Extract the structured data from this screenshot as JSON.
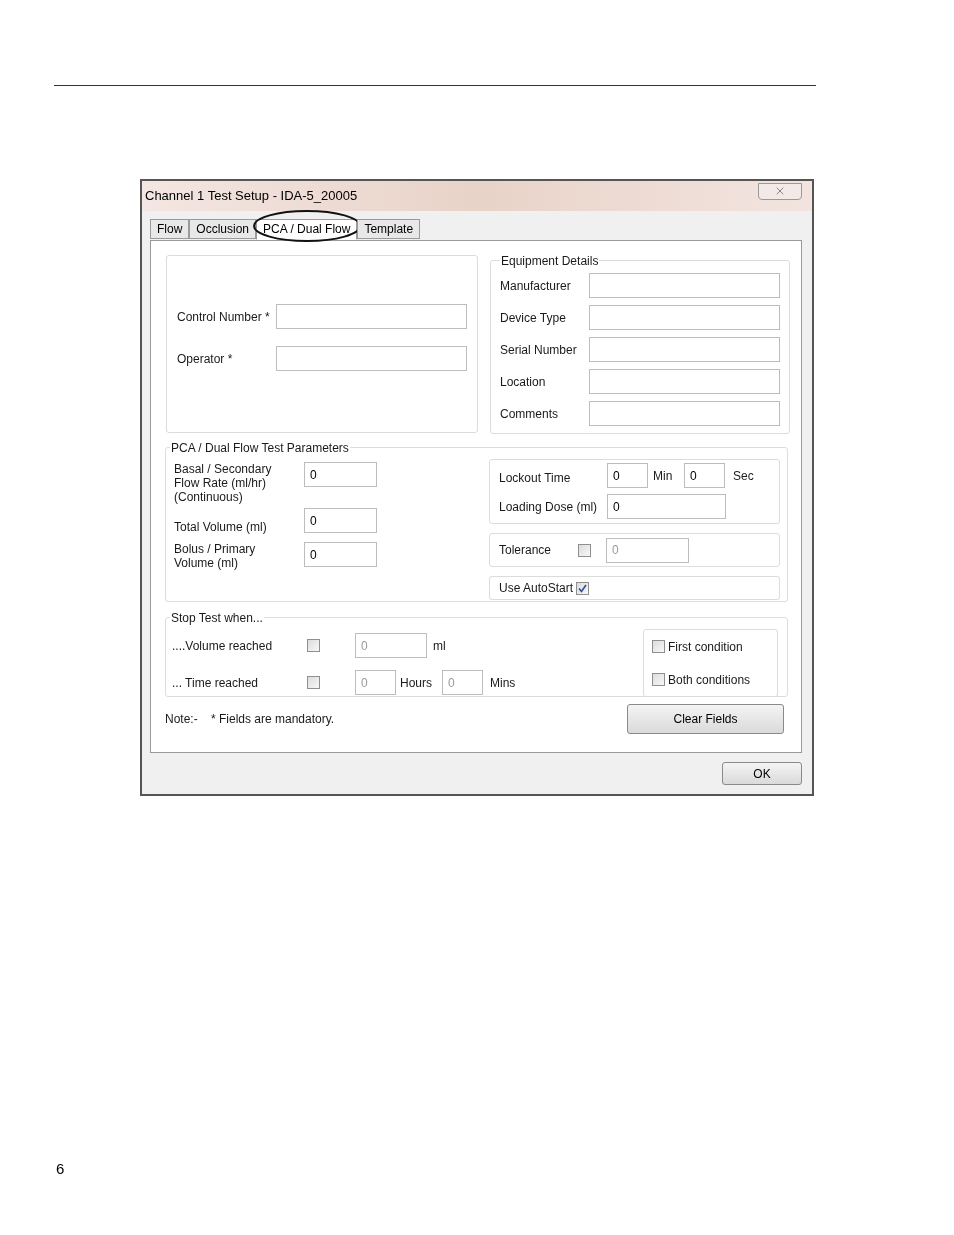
{
  "page": {
    "page_number": "6"
  },
  "dialog": {
    "title": "Channel 1 Test Setup - IDA-5_20005"
  },
  "tabs": [
    {
      "label": "Flow",
      "selected": false,
      "circled": false
    },
    {
      "label": "Occlusion",
      "selected": false,
      "circled": false
    },
    {
      "label": "PCA / Dual Flow",
      "selected": true,
      "circled": true
    },
    {
      "label": "Template",
      "selected": false,
      "circled": false
    }
  ],
  "operator_panel": {
    "fields": [
      {
        "label": "Control Number *"
      },
      {
        "label": "Operator *"
      }
    ]
  },
  "equipment_details": {
    "title": "Equipment Details",
    "fields": [
      {
        "label": "Manufacturer"
      },
      {
        "label": "Device Type"
      },
      {
        "label": "Serial Number"
      },
      {
        "label": "Location"
      },
      {
        "label": "Comments"
      }
    ]
  },
  "test_parameters": {
    "title": "PCA / Dual Flow Test Parameters",
    "fields": [
      {
        "label_lines": [
          "Basal / Secondary",
          "Flow Rate (ml/hr)",
          "(Continuous)"
        ],
        "value": "0",
        "disabled": false
      },
      {
        "label_lines": [
          "Total Volume (ml)"
        ],
        "value": "0",
        "disabled": false
      },
      {
        "label_lines": [
          "Bolus / Primary",
          "Volume  (ml)"
        ],
        "value": "0",
        "disabled": false
      }
    ],
    "lockout": {
      "label": "Lockout Time",
      "minutes": "0",
      "min_unit": "Min",
      "seconds": "0",
      "sec_unit": "Sec"
    },
    "loading_dose": {
      "label": "Loading Dose (ml)",
      "value": "0"
    },
    "tolerance": {
      "label": "Tolerance",
      "checked": false,
      "value": "0",
      "disabled": true
    },
    "autostart": {
      "label": "Use AutoStart",
      "checked": true
    }
  },
  "stop_test": {
    "title": "Stop Test when...",
    "volume": {
      "label": "....Volume reached",
      "checked": false,
      "value": "0",
      "unit": "ml",
      "disabled": true
    },
    "time": {
      "label": "... Time reached",
      "checked": false,
      "hours": "0",
      "hours_unit": "Hours",
      "mins": "0",
      "mins_unit": "Mins",
      "disabled": true
    },
    "conditions": [
      {
        "label": "First condition",
        "checked": false
      },
      {
        "label": "Both conditions",
        "checked": false
      }
    ]
  },
  "note": {
    "prefix": "Note:-",
    "text": "* Fields are mandatory."
  },
  "buttons": {
    "clear": "Clear Fields",
    "ok": "OK"
  }
}
